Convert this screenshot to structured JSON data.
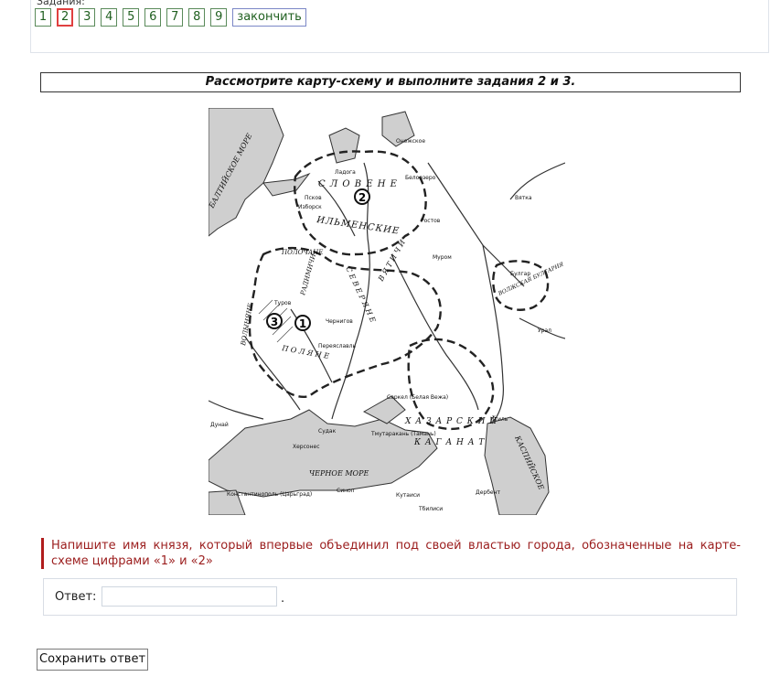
{
  "nav": {
    "caption": "Задания:",
    "buttons": [
      "1",
      "2",
      "3",
      "4",
      "5",
      "6",
      "7",
      "8",
      "9"
    ],
    "active_index": 1,
    "finish_label": "закончить",
    "active_color": "#e04040",
    "button_color": "#5a8a5a"
  },
  "task": {
    "header": "Рассмотрите карту-схему и выполните задания 2 и 3."
  },
  "map": {
    "labels": {
      "baltic_sea": "БАЛТИЙСКОЕ МОРЕ",
      "slovene": "С Л О В Е Н Е",
      "ilmen": "ИЛЬМЕНСКИЕ",
      "volga_bulgaria": "ВОЛЖСКАЯ БУЛГАРИЯ",
      "bulgar": "Булгар",
      "khazar": "Х А З А Р С К И Й",
      "kaganat": "К А Г А Н А Т",
      "black_sea": "ЧЕРНОЕ МОРЕ",
      "caspian": "КАСПИЙСКОЕ",
      "polyane": "П О Л Я Н Е",
      "severyane": "С Е В Е Р Я Н Е",
      "vyatichi": "В Я Т И Ч И",
      "volynyane": "ВОЛЫНЯНЕ",
      "polochane": "ПОЛОЧАНЕ",
      "radimichi": "РАДИМИЧИ",
      "ladoga": "Ладога",
      "pskov": "Псков",
      "izborsk": "Изборск",
      "rostov": "Ростов",
      "murom": "Муром",
      "beloozero": "Белоозеро",
      "onega": "Онежское",
      "chernigov": "Чернигов",
      "pereyaslavl": "Переяславль",
      "turov": "Туров",
      "sarkel": "Саркел (Белая Вежа)",
      "itil": "Итиль",
      "sudak": "Судак",
      "khersones": "Херсонес",
      "tmutarakan": "Тмутаракань (Тамань)",
      "konstantinopol": "Константинополь (Царьград)",
      "sinop": "Синоп",
      "kutaisi": "Кутаиси",
      "tbilisi": "Тбилиси",
      "derbent": "Дербент",
      "ural": "Урал",
      "dunai": "Дунай",
      "vyatka": "Вятка"
    },
    "markers": [
      "1",
      "2",
      "3"
    ],
    "land_color": "#ffffff",
    "water_color": "#cfcfcf"
  },
  "question": {
    "text": "Напишите имя князя, который впервые объединил под своей властью города, обозначенные на карте-схеме цифрами «1» и «2»",
    "color": "#9b1d1d"
  },
  "answer": {
    "label": "Ответ:",
    "value": "",
    "placeholder": "",
    "suffix": "."
  },
  "save": {
    "label": "Сохранить ответ"
  }
}
